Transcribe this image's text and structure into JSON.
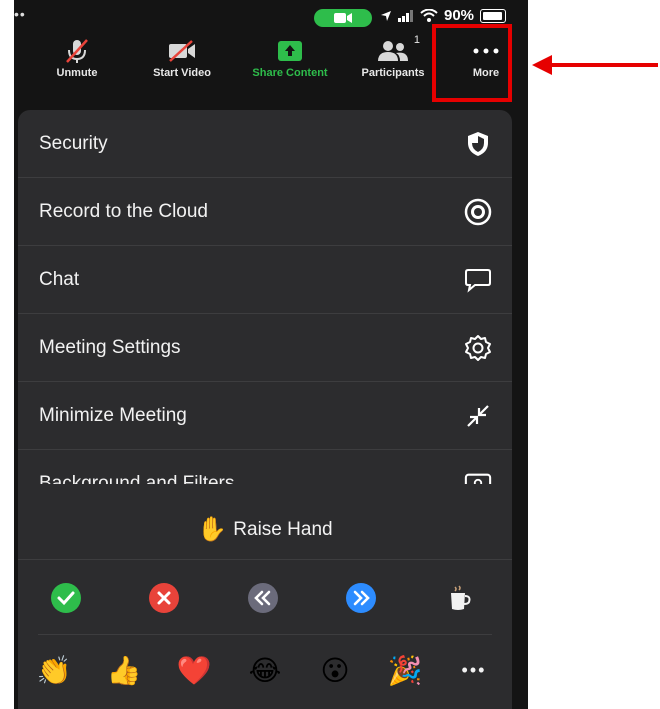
{
  "status_bar": {
    "battery_text": "90%",
    "left_dots": "••"
  },
  "toolbar": {
    "unmute": "Unmute",
    "start_video": "Start Video",
    "share_content": "Share Content",
    "participants": "Participants",
    "participants_count": "1",
    "more": "More"
  },
  "menu": {
    "items": [
      {
        "label": "Security",
        "icon": "shield-icon"
      },
      {
        "label": "Record to the Cloud",
        "icon": "record-icon"
      },
      {
        "label": "Chat",
        "icon": "chat-bubble-icon"
      },
      {
        "label": "Meeting Settings",
        "icon": "gear-icon"
      },
      {
        "label": "Minimize Meeting",
        "icon": "minimize-icon"
      },
      {
        "label": "Background and Filters",
        "icon": "background-icon"
      }
    ],
    "raise_hand": {
      "emoji": "✋",
      "label": "Raise Hand"
    },
    "feedback": [
      "check-icon",
      "x-icon",
      "slower-icon",
      "faster-icon",
      "coffee-icon"
    ],
    "reactions": [
      "👏",
      "👍",
      "❤️",
      "😂",
      "😮",
      "🎉"
    ],
    "more_reactions": "•••"
  },
  "colors": {
    "accent_green": "#2ebd4b",
    "highlight_red": "#e60000",
    "menu_bg": "#2c2c2e"
  }
}
